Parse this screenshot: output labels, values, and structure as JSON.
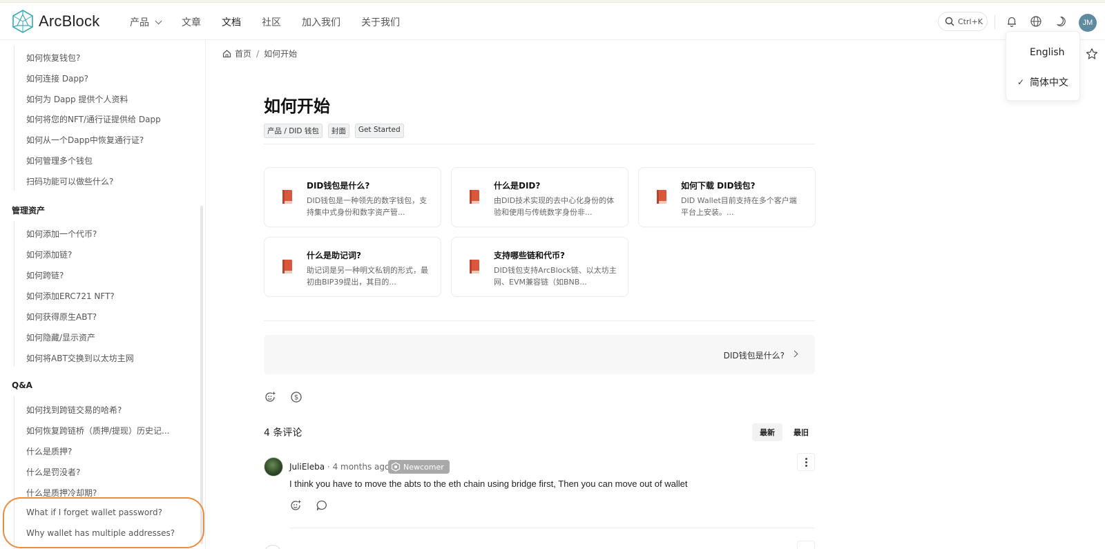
{
  "header": {
    "brand": "ArcBlock",
    "nav": [
      {
        "label": "产品",
        "has_dropdown": true
      },
      {
        "label": "文章"
      },
      {
        "label": "文档",
        "active": true
      },
      {
        "label": "社区"
      },
      {
        "label": "加入我们"
      },
      {
        "label": "关于我们"
      }
    ],
    "search_shortcut": "Ctrl+K",
    "icons": [
      "search-icon",
      "bell-icon",
      "globe-icon",
      "moon-icon"
    ],
    "avatar_initials": "JM"
  },
  "language_menu": {
    "items": [
      {
        "label": "English",
        "selected": false
      },
      {
        "label": "简体中文",
        "selected": true
      }
    ],
    "check_glyph": "✓"
  },
  "sidebar": {
    "group_top": [
      "如何恢复钱包?",
      "如何连接 Dapp?",
      "如何为 Dapp 提供个人资料",
      "如何将您的NFT/通行证提供给 Dapp",
      "如何从一个Dapp中恢复通行证?",
      "如何管理多个钱包",
      "扫码功能可以做些什么?"
    ],
    "sections": [
      {
        "title": "管理资产",
        "items": [
          "如何添加一个代币?",
          "如何添加链?",
          "如何跨链?",
          "如何添加ERC721 NFT?",
          "如何获得原生ABT?",
          "如何隐藏/显示资产",
          "如何将ABT交换到以太坊主网"
        ]
      },
      {
        "title": "Q&A",
        "items": [
          "如何找到跨链交易的哈希?",
          "如何恢复跨链桥（质押/提现）历史记...",
          "什么是质押?",
          "什么是罚没者?",
          "什么是质押冷却期?",
          "What if I forget wallet password?",
          "Why wallet has multiple addresses?"
        ]
      }
    ]
  },
  "breadcrumb": {
    "home": "首页",
    "separator": "/",
    "current": "如何开始"
  },
  "page": {
    "title": "如何开始",
    "tags": [
      "产品 / DID 钱包",
      "封面",
      "Get Started"
    ]
  },
  "cards": [
    {
      "title": "DID钱包是什么?",
      "desc": "DID钱包是一种领先的数字钱包，支持集中式身份和数字资产管..."
    },
    {
      "title": "什么是DID?",
      "desc": "由DID技术实现的去中心化身份的体验和使用与传统数字身份非..."
    },
    {
      "title": "如何下载 DID钱包?",
      "desc": "DID Wallet目前支持在多个客户端平台上安装。..."
    },
    {
      "title": "什么是助记词?",
      "desc": "助记词是另一种明文私钥的形式，最初由BIP39提出，其目的..."
    },
    {
      "title": "支持哪些链和代币?",
      "desc": "DID钱包支持ArcBlock链、以太坊主网、EVM兼容链（如BNB..."
    }
  ],
  "next_link": "DID钱包是什么?",
  "comments": {
    "count_label": "4 条评论",
    "sort": {
      "newest": "最新",
      "oldest": "最旧"
    },
    "items": [
      {
        "author": "JuliEleba",
        "separator": "·",
        "time": "4 months ago",
        "badge": "Newcomer",
        "text": "I think you have to move the abts to the eth chain using bridge first, Then you can move out of wallet"
      }
    ]
  },
  "colors": {
    "highlight_outline": "#f08a3c",
    "logo_teal": "#38a9b6",
    "book_red": "#d9573c",
    "avatar_bg": "#5f8aa0"
  }
}
